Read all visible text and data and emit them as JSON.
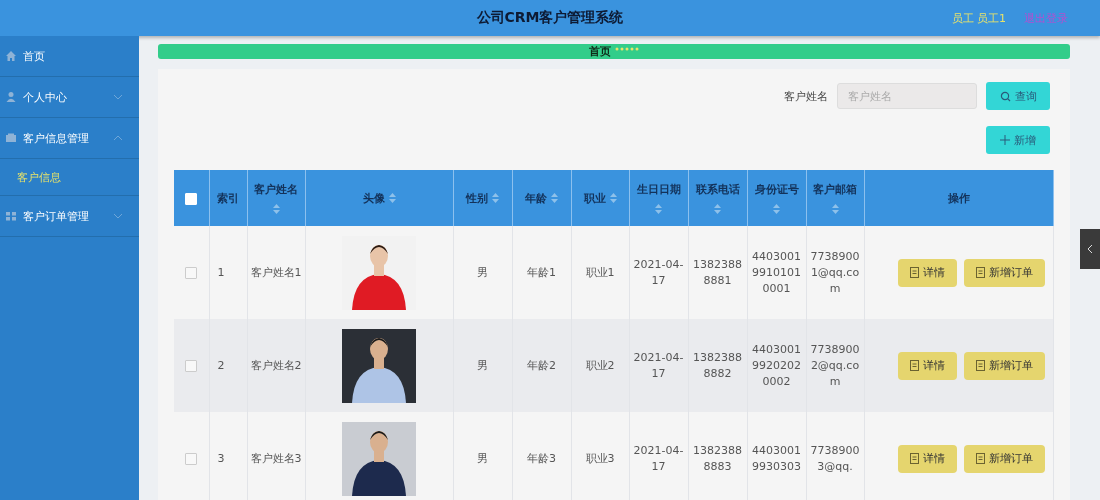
{
  "header": {
    "title": "公司CRM客户管理系统",
    "user": "员工 员工1",
    "logout": "退出登录"
  },
  "sidebar": {
    "items": [
      {
        "label": "首页"
      },
      {
        "label": "个人中心",
        "expanded": false
      },
      {
        "label": "客户信息管理",
        "expanded": true,
        "children": [
          {
            "label": "客户信息",
            "selected": true
          }
        ]
      },
      {
        "label": "客户订单管理",
        "expanded": false
      }
    ]
  },
  "breadcrumb": {
    "home": "首页"
  },
  "search": {
    "label": "客户姓名",
    "placeholder": "客户姓名",
    "button": "查询"
  },
  "add_button": "新增",
  "table": {
    "select_all": {
      "checked": false
    },
    "columns": [
      {
        "label": "索引",
        "sortable": false
      },
      {
        "label": "客户姓名",
        "sortable": true
      },
      {
        "label": "头像",
        "sortable": true
      },
      {
        "label": "性别",
        "sortable": true
      },
      {
        "label": "年龄",
        "sortable": true
      },
      {
        "label": "职业",
        "sortable": true
      },
      {
        "label": "生日日期",
        "sortable": true
      },
      {
        "label": "联系电话",
        "sortable": true
      },
      {
        "label": "身份证号",
        "sortable": true
      },
      {
        "label": "客户邮箱",
        "sortable": true
      },
      {
        "label": "操作",
        "sortable": false
      }
    ],
    "rows": [
      {
        "checked": false,
        "index": "1",
        "name": "客户姓名1",
        "avatar": {
          "kind": "picture"
        },
        "gender": "男",
        "age": "年龄1",
        "job": "职业1",
        "dob": "2021-04-17",
        "phone": "13823888881",
        "id_number": "440300199101010001",
        "email": "77389001@qq.com",
        "actions": [
          "详情",
          "新增订单"
        ]
      },
      {
        "checked": false,
        "index": "2",
        "name": "客户姓名2",
        "avatar": {
          "kind": "picture"
        },
        "gender": "男",
        "age": "年龄2",
        "job": "职业2",
        "dob": "2021-04-17",
        "phone": "13823888882",
        "id_number": "440300199202020002",
        "email": "77389002@qq.com",
        "actions": [
          "详情",
          "新增订单"
        ]
      },
      {
        "checked": false,
        "index": "3",
        "name": "客户姓名3",
        "avatar": {
          "kind": "picture"
        },
        "gender": "男",
        "age": "年龄3",
        "job": "职业3",
        "dob": "2021-04-17",
        "phone": "13823888883",
        "id_number": "44030019930303",
        "email": "77389003@qq.",
        "actions": [
          "详情",
          "新增订单"
        ]
      }
    ]
  }
}
